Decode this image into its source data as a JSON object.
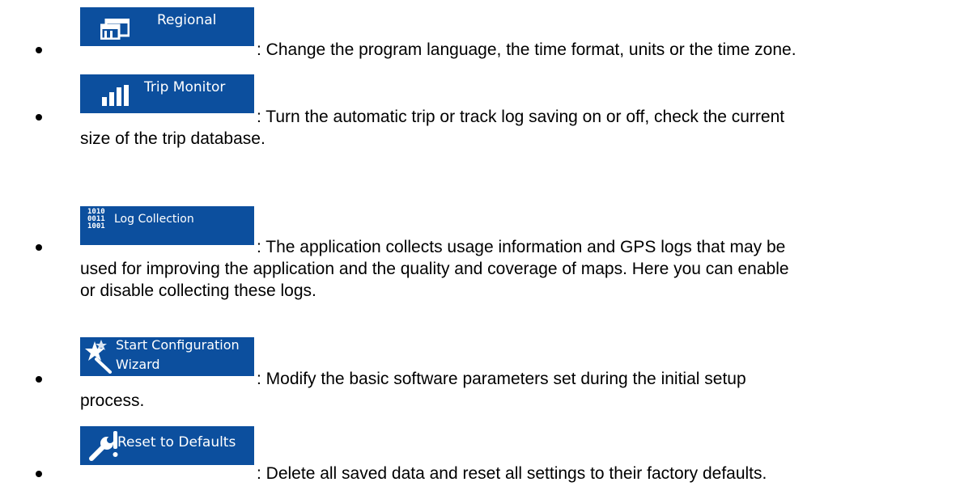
{
  "items": [
    {
      "button_label": "Regional",
      "icon": "regional-window-icon",
      "description_first": ": Change the program language, the time format, units or the time zone.",
      "description_rest": []
    },
    {
      "button_label": "Trip Monitor",
      "icon": "bar-chart-icon",
      "description_first": ": Turn the automatic trip or track log saving on or off, check the current",
      "description_rest": [
        "size of the trip database."
      ]
    },
    {
      "button_label": "Log Collection",
      "icon": "binary-digits-icon",
      "icon_text": "1010 0011 1001",
      "description_first": ": The application collects usage information and GPS logs that may be",
      "description_rest": [
        "used for improving the application and the quality and coverage of maps. Here you can enable",
        "or disable collecting these logs."
      ]
    },
    {
      "button_label_line1": "Start Configuration",
      "button_label_line2": "Wizard",
      "icon": "magic-wand-icon",
      "description_first": ": Modify the basic software parameters set during the initial setup",
      "description_rest": [
        "process."
      ]
    },
    {
      "button_label": "Reset to Defaults",
      "icon": "wrench-exclamation-icon",
      "description_first": ": Delete all saved data and reset all settings to their factory defaults.",
      "description_rest": []
    }
  ],
  "colors": {
    "button_bg": "#0c4f9e",
    "button_text": "#ffffff",
    "text": "#000000"
  }
}
